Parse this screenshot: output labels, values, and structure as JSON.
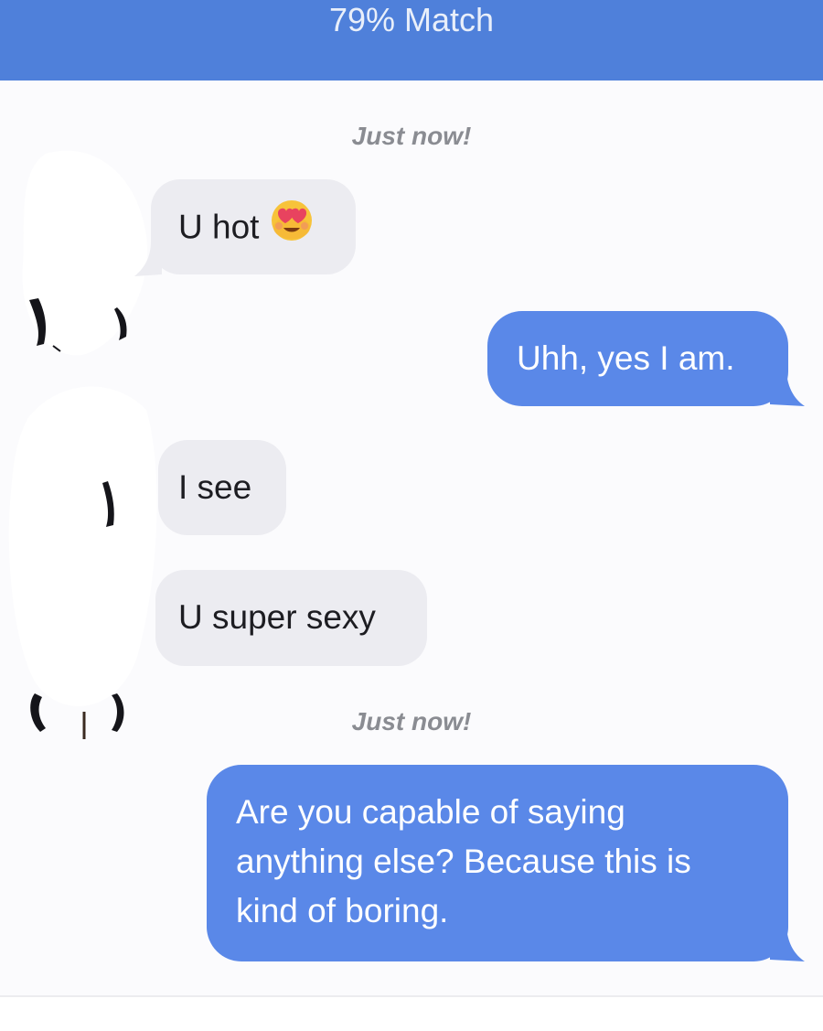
{
  "header": {
    "title": "79% Match"
  },
  "chat": {
    "groups": [
      {
        "timestamp": "Just now!",
        "messages": [
          {
            "direction": "incoming",
            "text": "U hot",
            "emoji": "smiling-face-with-heart-eyes"
          },
          {
            "direction": "outgoing",
            "text": "Uhh, yes I am."
          },
          {
            "direction": "incoming",
            "text": "I see"
          },
          {
            "direction": "incoming",
            "text": "U super sexy"
          }
        ]
      },
      {
        "timestamp": "Just now!",
        "messages": [
          {
            "direction": "outgoing",
            "text": "Are you capable of saying\nanything else? Because this is\nkind of boring."
          }
        ]
      }
    ]
  },
  "colors": {
    "header": "#4f80da",
    "outgoing_bubble": "#5a88e8",
    "incoming_bubble": "#ececf1",
    "timestamp": "#8a8c92",
    "background": "#fbfbfd"
  }
}
